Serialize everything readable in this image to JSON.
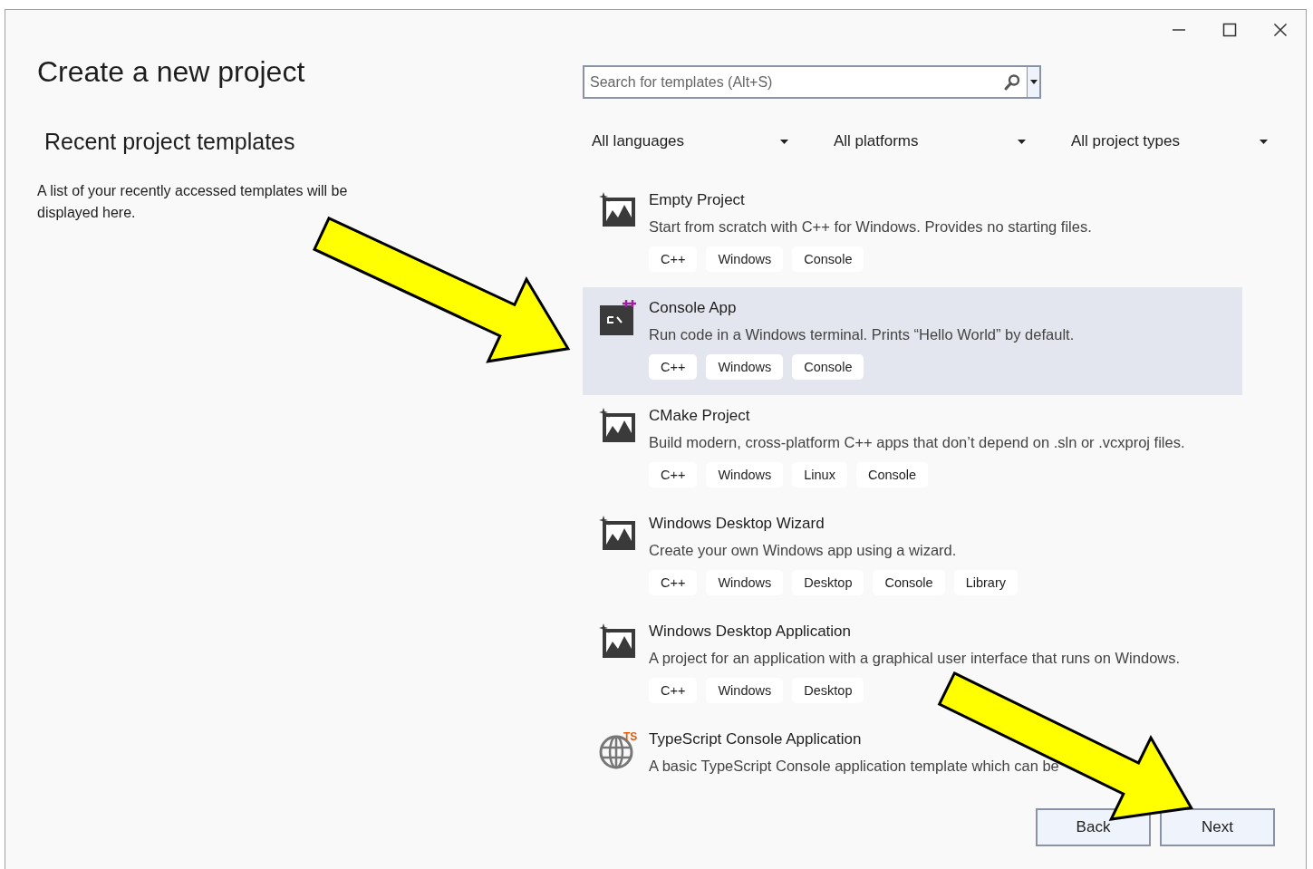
{
  "window": {
    "title": "Create a new project"
  },
  "recent": {
    "heading": "Recent project templates",
    "message": "A list of your recently accessed templates will be displayed here."
  },
  "search": {
    "placeholder": "Search for templates (Alt+S)"
  },
  "filters": [
    {
      "label": "All languages"
    },
    {
      "label": "All platforms"
    },
    {
      "label": "All project types"
    }
  ],
  "templates": [
    {
      "kind": "project",
      "title": "Empty Project",
      "description": "Start from scratch with C++ for Windows. Provides no starting files.",
      "tags": [
        "C++",
        "Windows",
        "Console"
      ],
      "selected": false
    },
    {
      "kind": "console",
      "title": "Console App",
      "description": "Run code in a Windows terminal. Prints “Hello World” by default.",
      "tags": [
        "C++",
        "Windows",
        "Console"
      ],
      "selected": true
    },
    {
      "kind": "project",
      "title": "CMake Project",
      "description": "Build modern, cross-platform C++ apps that don’t depend on .sln or .vcxproj files.",
      "tags": [
        "C++",
        "Windows",
        "Linux",
        "Console"
      ],
      "selected": false
    },
    {
      "kind": "project",
      "title": "Windows Desktop Wizard",
      "description": "Create your own Windows app using a wizard.",
      "tags": [
        "C++",
        "Windows",
        "Desktop",
        "Console",
        "Library"
      ],
      "selected": false
    },
    {
      "kind": "project",
      "title": "Windows Desktop Application",
      "description": "A project for an application with a graphical user interface that runs on Windows.",
      "tags": [
        "C++",
        "Windows",
        "Desktop"
      ],
      "selected": false
    },
    {
      "kind": "globe",
      "icon_badge": "TS",
      "title": "TypeScript Console Application",
      "description": "A basic TypeScript Console application template which can be",
      "selected": false
    }
  ],
  "buttons": [
    {
      "label": "Back"
    },
    {
      "label": "Next"
    }
  ]
}
